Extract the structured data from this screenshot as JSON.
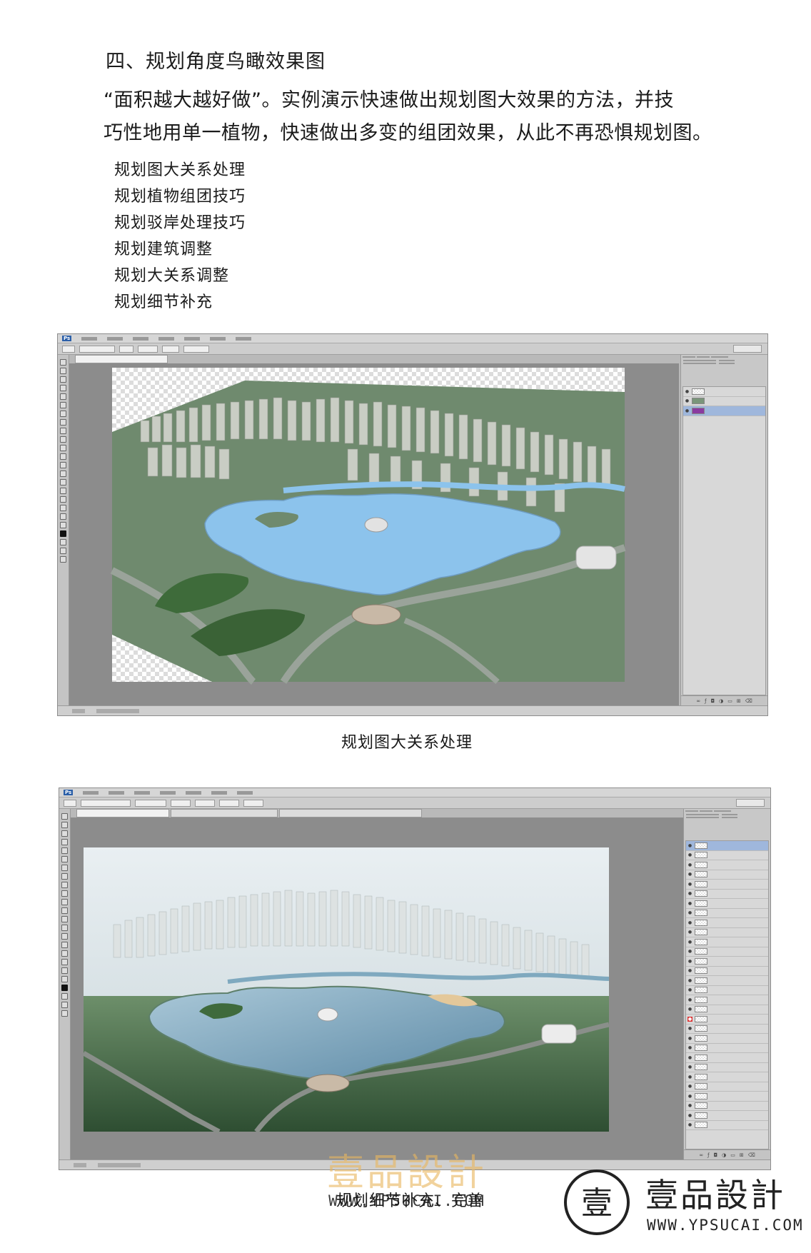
{
  "heading": "四、规划角度鸟瞰效果图",
  "intro": {
    "line1": "“面积越大越好做”。实例演示快速做出规划图大效果的方法，并技",
    "line2": "巧性地用单一植物，快速做出多变的组团效果，从此不再恐惧规划图。"
  },
  "topics": [
    "规划图大关系处理",
    "规划植物组团技巧",
    "规划驳岸处理技巧",
    "规划建筑调整",
    "规划大关系调整",
    "规划细节补充"
  ],
  "captions": {
    "first": "规划图大关系处理",
    "second": "规划细节补充、完善"
  },
  "watermark": {
    "brand_name": "壹品設計",
    "url": "WWW.YPSUCAI.COM",
    "logo_name": "壹品設計",
    "logo_url": "WWW.YPSUCAI.COM",
    "logo_glyph": "壹"
  },
  "colors": {
    "ground_green": "#6f8a6e",
    "water_blue": "#8cc3ec",
    "ps_chrome": "#c8c8c8",
    "selected_layer": "#9fb7dc",
    "watermark_orange": "#e8b660"
  }
}
